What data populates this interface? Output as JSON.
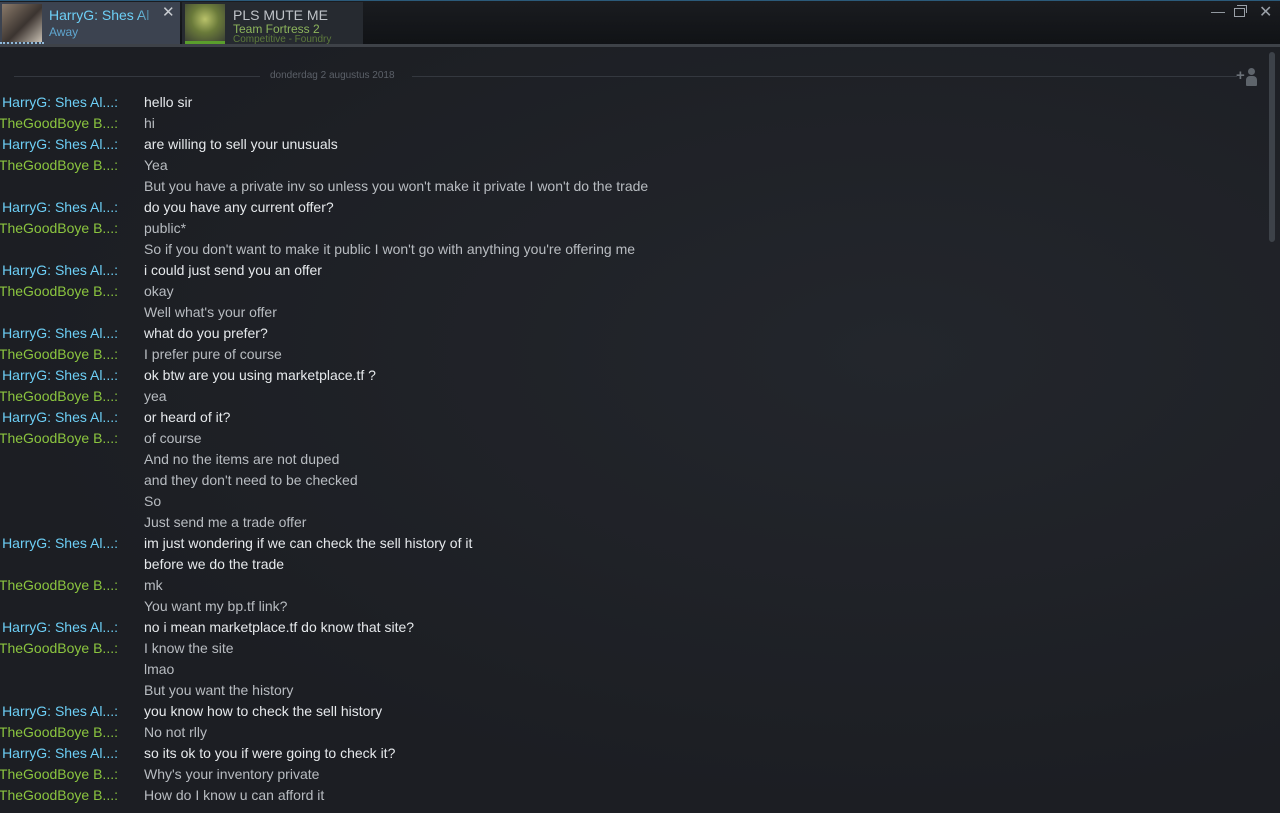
{
  "tabs": [
    {
      "name": "HarryG: Shes Al",
      "sub1": "Away",
      "sub2": "",
      "active": true
    },
    {
      "name": "PLS MUTE ME",
      "sub1": "Team Fortress 2",
      "sub2": "Competitive - Foundry",
      "active": false
    }
  ],
  "window": {
    "minimize": "—",
    "close": "✕"
  },
  "chat": {
    "date": "donderdag 2 augustus 2018",
    "add_friend_icon": "add-friend-icon",
    "messages": [
      {
        "sender": "HarryG: Shes Al...:",
        "who": "harry",
        "text": "hello sir"
      },
      {
        "sender": "TheGoodBoye B...:",
        "who": "good",
        "text": "hi"
      },
      {
        "sender": "HarryG: Shes Al...:",
        "who": "harry",
        "text": "are willing to sell your unusuals"
      },
      {
        "sender": "TheGoodBoye B...:",
        "who": "good",
        "text": "Yea"
      },
      {
        "sender": "",
        "who": "good",
        "text": "But you have a private inv so unless you won't make it private I won't do the trade"
      },
      {
        "sender": "HarryG: Shes Al...:",
        "who": "harry",
        "text": "do you have any current offer?"
      },
      {
        "sender": "TheGoodBoye B...:",
        "who": "good",
        "text": "public*"
      },
      {
        "sender": "",
        "who": "good",
        "text": "So if you don't want to make it public I won't go with anything you're offering me"
      },
      {
        "sender": "HarryG: Shes Al...:",
        "who": "harry",
        "text": "i could just send you an offer"
      },
      {
        "sender": "TheGoodBoye B...:",
        "who": "good",
        "text": "okay"
      },
      {
        "sender": "",
        "who": "good",
        "text": "Well what's your offer"
      },
      {
        "sender": "HarryG: Shes Al...:",
        "who": "harry",
        "text": "what do you prefer?"
      },
      {
        "sender": "TheGoodBoye B...:",
        "who": "good",
        "text": "I prefer pure of course"
      },
      {
        "sender": "HarryG: Shes Al...:",
        "who": "harry",
        "text": "ok btw are you using marketplace.tf ?"
      },
      {
        "sender": "TheGoodBoye B...:",
        "who": "good",
        "text": "yea"
      },
      {
        "sender": "HarryG: Shes Al...:",
        "who": "harry",
        "text": "or heard of it?"
      },
      {
        "sender": "TheGoodBoye B...:",
        "who": "good",
        "text": "of course"
      },
      {
        "sender": "",
        "who": "good",
        "text": "And no the items are not duped"
      },
      {
        "sender": "",
        "who": "good",
        "text": "and they don't need to be checked"
      },
      {
        "sender": "",
        "who": "good",
        "text": "So"
      },
      {
        "sender": "",
        "who": "good",
        "text": "Just send me a trade offer"
      },
      {
        "sender": "HarryG: Shes Al...:",
        "who": "harry",
        "text": "im just wondering if we can check the sell history of it"
      },
      {
        "sender": "",
        "who": "harry",
        "text": "before we do the trade"
      },
      {
        "sender": "TheGoodBoye B...:",
        "who": "good",
        "text": "mk"
      },
      {
        "sender": "",
        "who": "good",
        "text": "You want my bp.tf link?"
      },
      {
        "sender": "HarryG: Shes Al...:",
        "who": "harry",
        "text": "no i mean marketplace.tf do know that site?"
      },
      {
        "sender": "TheGoodBoye B...:",
        "who": "good",
        "text": "I know the site"
      },
      {
        "sender": "",
        "who": "good",
        "text": "lmao"
      },
      {
        "sender": "",
        "who": "good",
        "text": "But you want the history"
      },
      {
        "sender": "HarryG: Shes Al...:",
        "who": "harry",
        "text": "you know how to check the sell history"
      },
      {
        "sender": "TheGoodBoye B...:",
        "who": "good",
        "text": "No not rlly"
      },
      {
        "sender": "HarryG: Shes Al...:",
        "who": "harry",
        "text": "so its ok to you if were going to check it?"
      },
      {
        "sender": "TheGoodBoye B...:",
        "who": "good",
        "text": "Why's your inventory private"
      },
      {
        "sender": "TheGoodBoye B...:",
        "who": "good",
        "text": "How do I know u can afford it"
      }
    ]
  }
}
